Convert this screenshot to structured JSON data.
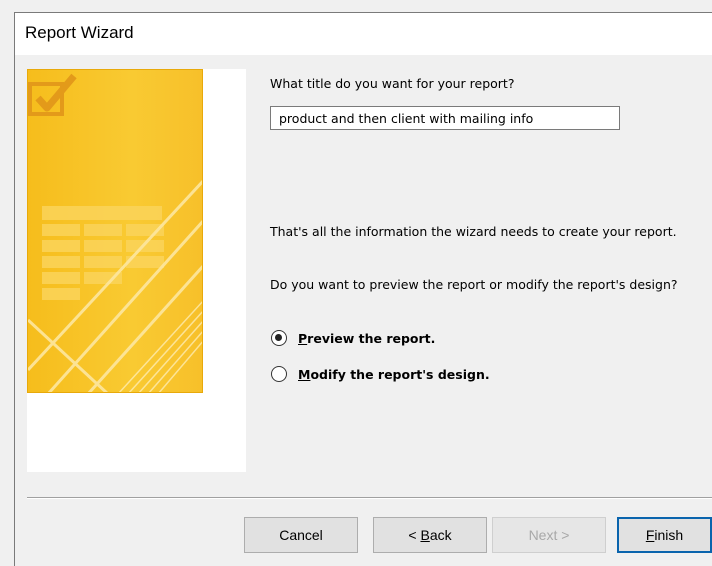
{
  "window": {
    "title": "Report Wizard"
  },
  "title_prompt": "What title do you want for your report?",
  "title_input": {
    "value": "product and then client with mailing info"
  },
  "info_text": "That's all the information the wizard needs to create your report.",
  "question_text": "Do you want to preview the report or modify the report's design?",
  "options": [
    {
      "accel": "P",
      "rest": "review the report.",
      "selected": true
    },
    {
      "accel": "M",
      "rest": "odify the report's design.",
      "selected": false
    }
  ],
  "buttons": {
    "cancel": "Cancel",
    "back_prefix": "< ",
    "back_accel": "B",
    "back_rest": "ack",
    "next": "Next >",
    "finish_accel": "F",
    "finish_rest": "inish"
  },
  "colors": {
    "art_yellow": "#f9ca32",
    "default_button_border": "#0a64ad"
  },
  "icons": {
    "art_badge": "checkbox-check-icon"
  }
}
